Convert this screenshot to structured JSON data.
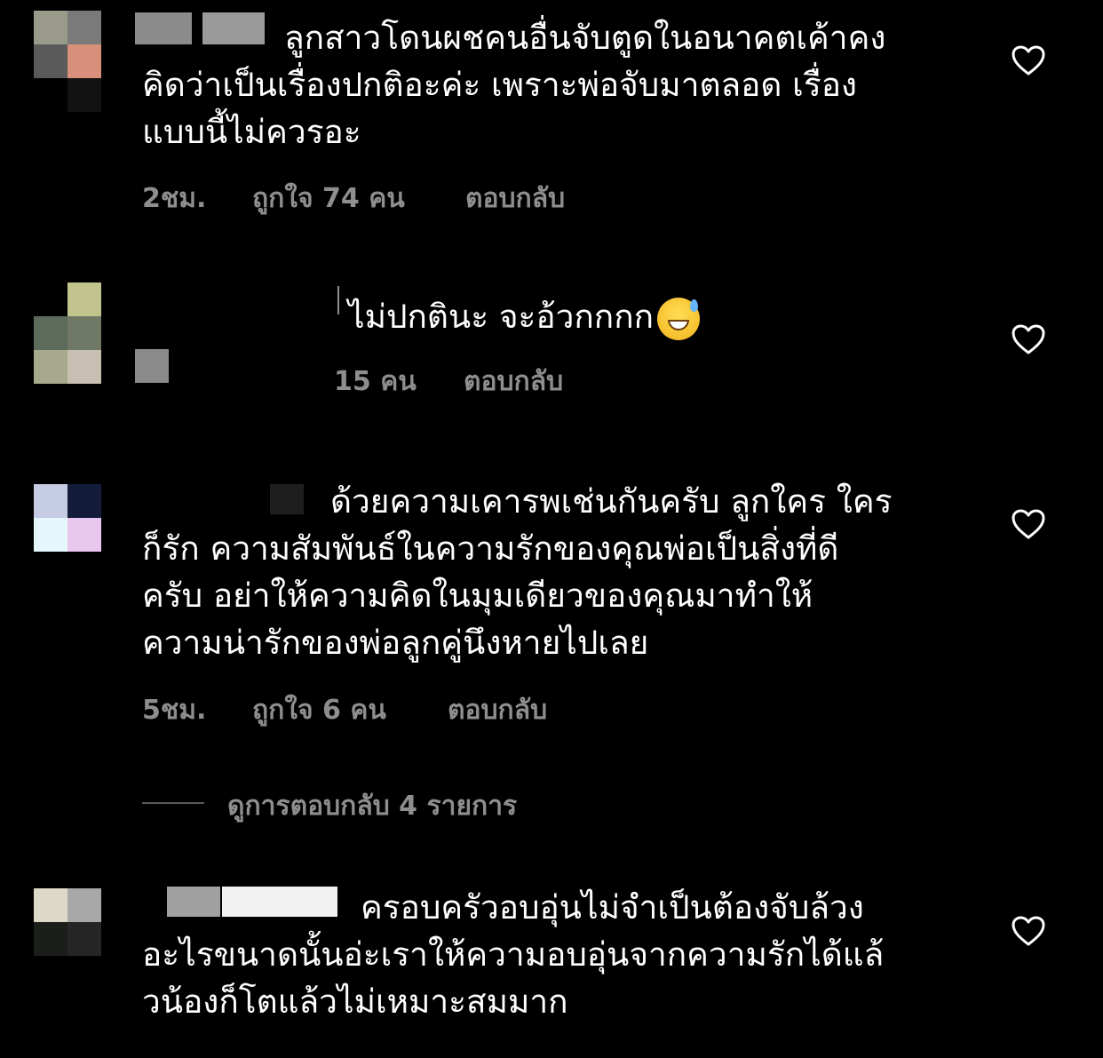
{
  "comments": [
    {
      "text_lines": [
        "ลูกสาวโดนผชคนอื่นจับตูดในอนาคตเค้าคง",
        "คิดว่าเป็นเรื่องปกติอะค่ะ เพราะพ่อจับมาตลอด เรื่อง",
        "แบบนี้ไม่ควรอะ"
      ],
      "time": "2ชม.",
      "likes": "ถูกใจ 74 คน",
      "reply": "ตอบกลับ"
    },
    {
      "text_lines": [
        "ไม่ปกตินะ จะอ้วกกกก"
      ],
      "likes": "15 คน",
      "reply": "ตอบกลับ"
    },
    {
      "text_lines": [
        "ด้วยความเคารพเช่นกันครับ ลูกใคร ใคร",
        "ก็รัก ความสัมพันธ์ในความรักของคุณพ่อเป็นสิ่งที่ดี",
        "ครับ อย่าให้ความคิดในมุมเดียวของคุณมาทำให้",
        "ความน่ารักของพ่อลูกคู่นึงหายไปเลย"
      ],
      "time": "5ชม.",
      "likes": "ถูกใจ 6 คน",
      "reply": "ตอบกลับ",
      "view_replies": "ดูการตอบกลับ 4 รายการ"
    },
    {
      "text_lines": [
        "ครอบครัวอบอุ่นไม่จำเป็นต้องจับล้วง",
        "อะไรขนาดนั้นอ่ะเราให้ความอบอุ่นจากความรักได้แล้",
        "วน้องก็โตแล้วไม่เหมาะสมมาก"
      ]
    }
  ],
  "icons": {
    "like": "heart-outline-icon",
    "emoji": "grinning-face-with-sweat-emoji"
  },
  "colors": {
    "background": "#000000",
    "text": "#ffffff",
    "meta": "#8e8e8e"
  }
}
